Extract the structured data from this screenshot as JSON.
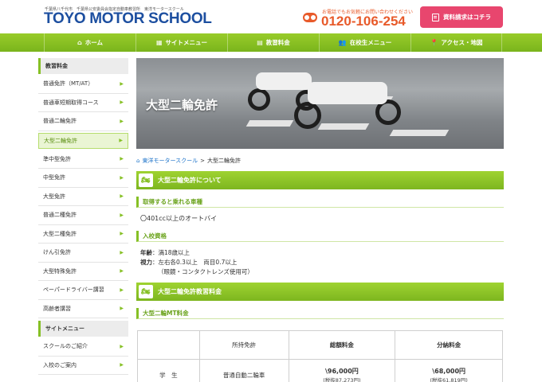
{
  "header": {
    "tagline": "千葉県八千代市　千葉県公安委員会指定自動車教習所　東洋モータースクール",
    "logo": "TOYO MOTOR SCHOOL",
    "phone_note": "お電話でもお気軽にお問い合わせください",
    "phone": "0120-106-254",
    "request_button": "資料請求はコチラ"
  },
  "nav": [
    {
      "label": "ホーム",
      "icon": "home-icon",
      "glyph": "⌂"
    },
    {
      "label": "サイトメニュー",
      "icon": "sitemap-icon",
      "glyph": "▦"
    },
    {
      "label": "教習料金",
      "icon": "fee-table-icon",
      "glyph": "▤"
    },
    {
      "label": "在校生メニュー",
      "icon": "student-icon",
      "glyph": "👥"
    },
    {
      "label": "アクセス・地図",
      "icon": "map-pin-icon",
      "glyph": "📍"
    }
  ],
  "sidebar": {
    "section1": "教習料金",
    "items": [
      "普通免許（MT/AT）",
      "普通車短期取得コース",
      "普通二輪免許",
      "大型二輪免許",
      "準中型免許",
      "中型免許",
      "大型免許",
      "普通二種免許",
      "大型二種免許",
      "けん引免許",
      "大型特殊免許",
      "ペーパードライバー講習",
      "高齢者講習"
    ],
    "active_index": 3,
    "section2": "サイトメニュー",
    "items2": [
      "スクールのご紹介",
      "入校のご案内"
    ]
  },
  "hero": {
    "title": "大型二輪免許"
  },
  "breadcrumb": {
    "home": "東洋モータースクール",
    "separator": ">",
    "current": "大型二輪免許"
  },
  "section_about": {
    "title": "大型二輪免許について",
    "vehicle_heading": "取得すると乗れる車種",
    "vehicle_text": "〇401cc以上のオートバイ",
    "qualification_heading": "入校資格",
    "age_label": "年齢",
    "age_value": "：満18歳以上",
    "vision_label": "視力",
    "vision_value": "：左右各0.3以上　両目0.7以上",
    "vision_note": "（眼鏡・コンタクトレンズ使用可）"
  },
  "section_fee": {
    "title": "大型二輪免許教習料金",
    "mt_heading": "大型二輪MT料金",
    "table": {
      "headers": [
        "",
        "所持免許",
        "総額料金",
        "分納料金"
      ],
      "rows": [
        {
          "category": "学　生",
          "license": "普通自動二輪車",
          "total_price": "\\96,000円",
          "total_tax": "(税抜87,273円)",
          "installment_price": "\\68,000円",
          "installment_tax": "(税抜61,819円)"
        }
      ]
    }
  },
  "colors": {
    "brand_blue": "#1d4fa0",
    "accent_green": "#86c025",
    "phone_orange": "#e85a2a",
    "request_pink": "#e8466e"
  }
}
